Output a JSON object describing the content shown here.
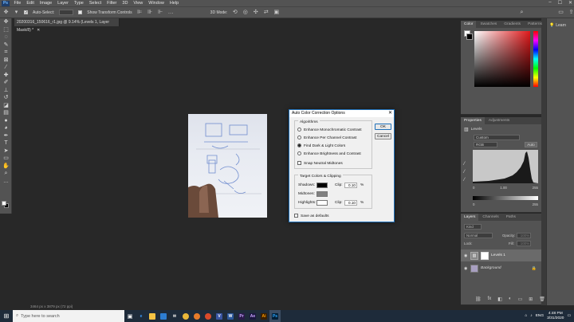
{
  "menubar": {
    "logo": "Ps",
    "items": [
      "File",
      "Edit",
      "Image",
      "Layer",
      "Type",
      "Select",
      "Filter",
      "3D",
      "View",
      "Window",
      "Help"
    ]
  },
  "options": {
    "auto_select": "Auto-Select:",
    "show_transform": "Show Transform Controls",
    "mode_3d": "3D Mode:"
  },
  "document": {
    "tab_title": "20200316_150616_r1.jpg @ 9.14% (Levels 1, Layer Mask/8) *",
    "status": "3464 px x 3879 px (72 ppi)"
  },
  "right_strip": {
    "learn_label": "Learn"
  },
  "color_panel": {
    "tabs": [
      "Color",
      "Swatches",
      "Gradients",
      "Patterns"
    ],
    "fg_color": "#ffffff",
    "bg_color": "#000000",
    "picker_hue": "#e0191b"
  },
  "properties_panel": {
    "tabs": [
      "Properties",
      "Adjustments"
    ],
    "kind": "Levels",
    "preset": "Custom",
    "channel": "RGB",
    "auto_label": "Auto",
    "input_values": [
      "0",
      "1.00",
      "255"
    ],
    "output_values": [
      "0",
      "255"
    ]
  },
  "layers_panel": {
    "tabs": [
      "Layers",
      "Channels",
      "Paths"
    ],
    "search_placeholder": "Kind",
    "blend_mode": "Normal",
    "opacity_label": "Opacity:",
    "opacity_value": "100%",
    "lock_label": "Lock:",
    "fill_label": "Fill:",
    "fill_value": "100%",
    "layers": [
      {
        "name": "Levels 1",
        "selected": true
      },
      {
        "name": "Background",
        "selected": false
      }
    ]
  },
  "dialog": {
    "title": "Auto Color Correction Options",
    "algorithms_label": "Algorithms",
    "options": [
      {
        "label": "Enhance Monochromatic Contrast",
        "checked": false
      },
      {
        "label": "Enhance Per Channel Contrast",
        "checked": false
      },
      {
        "label": "Find Dark & Light Colors",
        "checked": true
      },
      {
        "label": "Enhance Brightness and Contrast",
        "checked": false
      }
    ],
    "snap_label": "Snap Neutral Midtones",
    "target_label": "Target Colors & Clipping",
    "shadows_label": "Shadows:",
    "midtones_label": "Midtones:",
    "highlights_label": "Highlights:",
    "clip_label": "Clip:",
    "shadows_clip": "0.10",
    "highlights_clip": "0.10",
    "percent": "%",
    "shadows_color": "#000000",
    "midtones_color": "#808080",
    "highlights_color": "#ffffff",
    "ok_label": "OK",
    "cancel_label": "Cancel",
    "save_defaults": "Save as defaults"
  },
  "taskbar": {
    "search_placeholder": "Type here to search",
    "lang": "ENG",
    "time": "4:48 PM",
    "date": "3/31/2020"
  }
}
